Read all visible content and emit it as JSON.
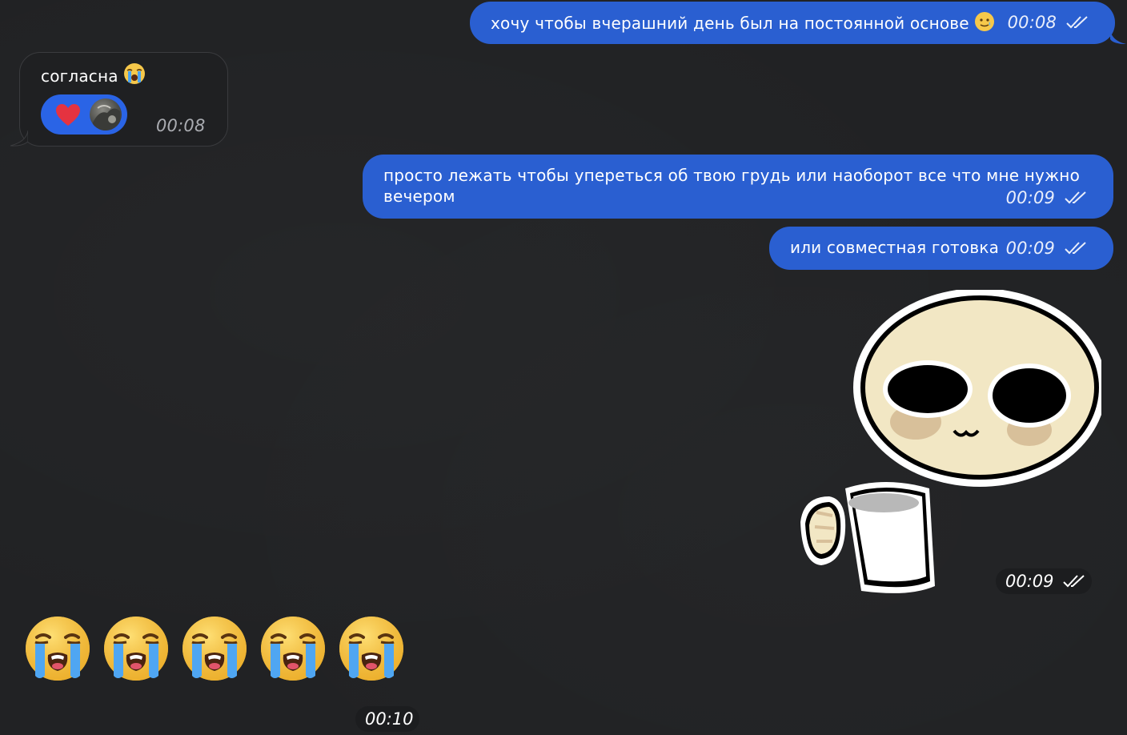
{
  "messages": [
    {
      "id": "m1",
      "direction": "outgoing",
      "text": "хочу чтобы вчерашний день был на постоянной основе",
      "emoji": "pleading-smile-emoji",
      "time": "00:08",
      "status": "read"
    },
    {
      "id": "m2",
      "direction": "incoming",
      "text": "согласна",
      "emoji": "loudly-crying-emoji",
      "time": "00:08",
      "reaction": {
        "emoji": "red-heart-icon",
        "avatar": "user-avatar"
      }
    },
    {
      "id": "m3",
      "direction": "outgoing",
      "text_line1": "просто лежать чтобы упереться об твою грудь или наоборот все что мне нужно",
      "text_line2": "вечером",
      "time": "00:09",
      "status": "read"
    },
    {
      "id": "m4",
      "direction": "outgoing",
      "text": "или совместная готовка",
      "time": "00:09",
      "status": "read"
    },
    {
      "id": "sticker",
      "direction": "outgoing",
      "type": "sticker",
      "sticker": "blob-with-mug-sticker",
      "time": "00:09",
      "status": "read"
    },
    {
      "id": "emoji-message",
      "direction": "incoming",
      "type": "big-emoji",
      "emoji": "loudly-crying-emoji",
      "count": 5,
      "time": "00:10"
    }
  ],
  "colors": {
    "background": "#212224",
    "outgoing_bubble": "#2a5fd1",
    "incoming_bubble": "#1f2022",
    "reaction_pill": "#2a64e6"
  }
}
